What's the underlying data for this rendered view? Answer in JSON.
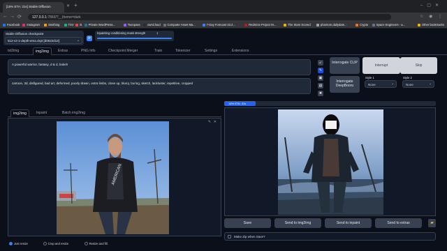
{
  "browser": {
    "tab_title": "[15% ETA: 31s] Stable Diffusion",
    "url_host": "127.0.0.1",
    "url_rest": ":7860/?__theme=dark",
    "bookmarks": [
      {
        "label": "Facebook",
        "color": "#1877f2"
      },
      {
        "label": "Instagram",
        "color": "#e1306c"
      },
      {
        "label": "Smithing",
        "color": "#f59e0b"
      },
      {
        "label": "TSV",
        "color": "#10b981"
      },
      {
        "label": "B",
        "color": "#ef4444"
      },
      {
        "label": "Private WordPress...",
        "color": "#21759b"
      },
      {
        "label": "Toonpass",
        "color": "#a855f7"
      },
      {
        "label": "ownCloud",
        "color": "#1d2d44"
      },
      {
        "label": "Computer Asset Ma...",
        "color": "#6b7280"
      },
      {
        "label": "7-Day Forecast 33.2...",
        "color": "#3b82f6"
      },
      {
        "label": "Redmine Project M...",
        "color": "#b91c1c"
      },
      {
        "label": "The Stars Scored",
        "color": "#eab308"
      },
      {
        "label": "phantom.dailydate...",
        "color": "#9ca3af"
      },
      {
        "label": "Crypto",
        "color": "#f97316"
      },
      {
        "label": "Space Engineers - a...",
        "color": "#64748b"
      },
      {
        "label": "Other bookmarks",
        "color": "#eab308"
      }
    ]
  },
  "settings": {
    "checkpoint_label": "Stable Diffusion checkpoint",
    "checkpoint_value": "512-v2-1-depth-ema.ckpt [d0522d12]",
    "slider_label": "Inpainting conditioning mask strength",
    "slider_value": "1",
    "slider_fraction": 1.0
  },
  "main_tabs": [
    "txt2img",
    "img2img",
    "Extras",
    "PNG Info",
    "Checkpoint Merger",
    "Train",
    "Tokenizer",
    "Settings",
    "Extensions"
  ],
  "active_main_tab": "img2img",
  "prompt": "A powerful warrior, fantasy, d & d, bokeh",
  "negative_prompt": "cartoon, 3d, disfigured, bad art, deformed, poorly drawn, extra limbs, close up, blurry, boring, sketch, lackluster, repetitive, cropped",
  "buttons": {
    "interrogate_clip": "Interrogate CLIP",
    "interrogate_deepbooru": "Interrogate DeepBooru",
    "interrupt": "Interrupt",
    "skip": "Skip"
  },
  "styles": [
    {
      "label": "Style 1",
      "value": "None"
    },
    {
      "label": "Style 2",
      "value": "None"
    }
  ],
  "progress": {
    "text": "15% ETA: 31s",
    "fraction": 0.15
  },
  "sub_tabs": [
    "img2img",
    "Inpaint",
    "Batch img2img"
  ],
  "output_buttons": [
    "Save",
    "Send to img2img",
    "Send to inpaint",
    "Send to extras"
  ],
  "make_zip_label": "Make Zip when Save?",
  "resize_options": [
    "Just resize",
    "Crop and resize",
    "Resize and fill"
  ],
  "input_image_caption": "AMERICAN"
}
